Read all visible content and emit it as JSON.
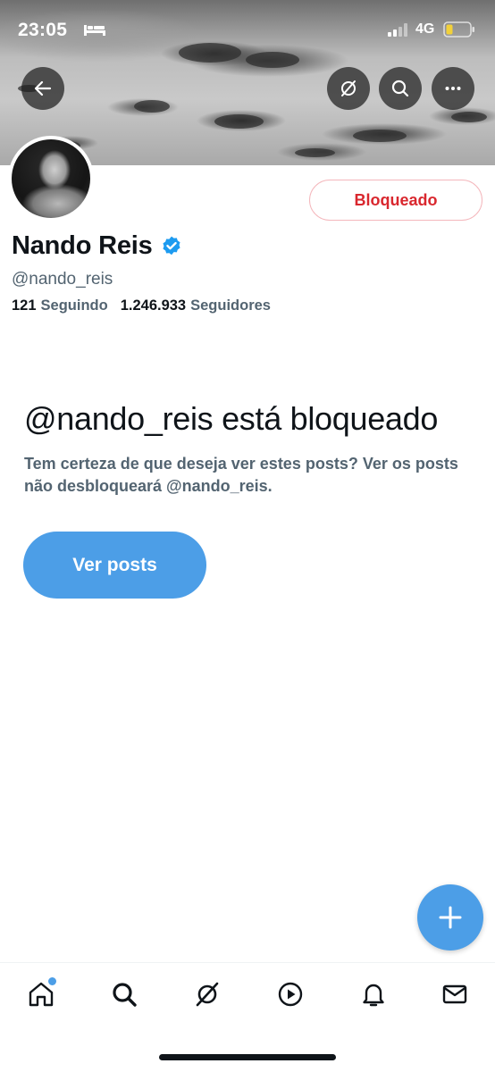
{
  "status_bar": {
    "time": "23:05",
    "network": "4G",
    "icons": [
      "sleep-bed-icon",
      "signal-icon",
      "battery-icon"
    ]
  },
  "header": {
    "buttons": [
      "back-arrow-icon",
      "grok-icon",
      "search-icon",
      "more-icon"
    ]
  },
  "profile": {
    "display_name": "Nando Reis",
    "handle": "@nando_reis",
    "verified": true,
    "following_count": "121",
    "following_label": "Seguindo",
    "followers_count": "1.246.933",
    "followers_label": "Seguidores",
    "blocked_button_label": "Bloqueado"
  },
  "blocked_notice": {
    "title": "@nando_reis está bloqueado",
    "description": "Tem certeza de que deseja ver estes posts? Ver os posts não desbloqueará @nando_reis.",
    "view_posts_label": "Ver posts"
  },
  "fab": {
    "icon": "plus-icon"
  },
  "bottom_nav": {
    "items": [
      {
        "icon": "home-icon",
        "has_dot": true
      },
      {
        "icon": "search-icon"
      },
      {
        "icon": "grok-icon"
      },
      {
        "icon": "play-icon"
      },
      {
        "icon": "bell-icon"
      },
      {
        "icon": "mail-icon"
      }
    ]
  },
  "colors": {
    "accent_blue": "#4c9ee7",
    "blocked_red": "#d9272e",
    "secondary_text": "#536471",
    "primary_text": "#0f1419"
  }
}
